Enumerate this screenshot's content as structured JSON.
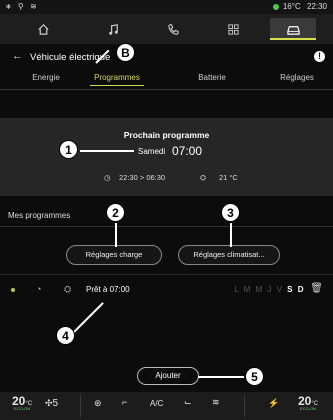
{
  "status": {
    "left_icons": "∗ ⚲ ≋",
    "temp": "16°C",
    "time": "22:30"
  },
  "nav": {
    "items": [
      {
        "icon": "home-icon"
      },
      {
        "icon": "music-note-icon"
      },
      {
        "icon": "phone-icon"
      },
      {
        "icon": "apps-grid-icon"
      },
      {
        "icon": "car-icon",
        "active": true
      }
    ]
  },
  "header": {
    "back": "←",
    "title": "Véhicule électrique",
    "info": "!"
  },
  "tabs": [
    "Energie",
    "Programmes",
    "Batterie",
    "Réglages"
  ],
  "next_program": {
    "title": "Prochain programme",
    "day": "Samedi",
    "time": "07:00",
    "charge_window": "22:30 > 06:30",
    "temperature": "21 °C"
  },
  "my_programs": {
    "label": "Mes programmes",
    "charge_settings": "Réglages charge",
    "climate_settings": "Réglages climatisat..."
  },
  "program_row": {
    "ready_text": "Prêt à 07:00",
    "days_inactive": "L M M J V",
    "days_active": "S D"
  },
  "add_button": "Ajouter",
  "callouts": [
    "B",
    "1",
    "2",
    "3",
    "4",
    "5"
  ],
  "bottom": {
    "left_temp": "20",
    "left_temp_unit": "°C",
    "left_mode": "ECO-ON",
    "fan_speed": "5",
    "ac_label": "A/C",
    "right_temp": "20",
    "right_temp_unit": "°C",
    "right_mode": "ECO-ON"
  },
  "colors": {
    "accent": "#d2d85a",
    "active_dot": "#b7c94a",
    "eco": "#6bd66b"
  }
}
